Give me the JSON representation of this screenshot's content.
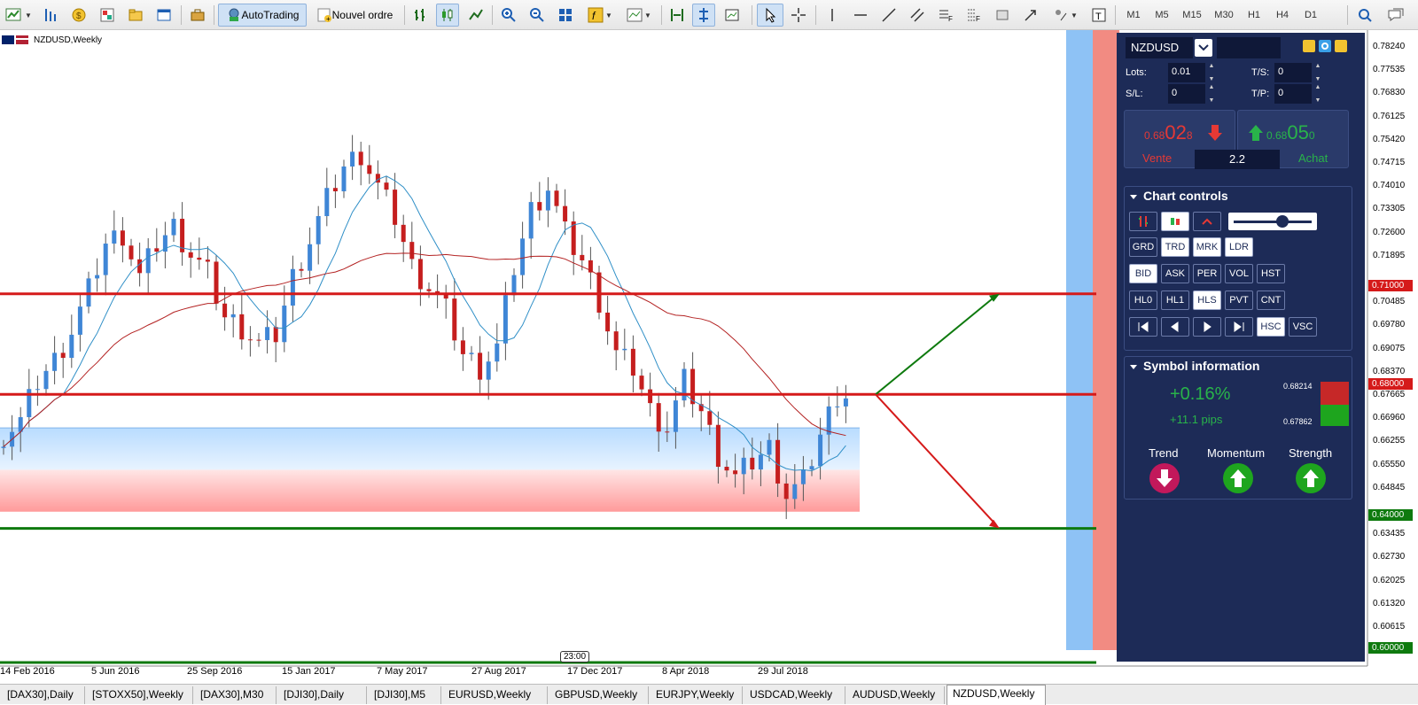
{
  "toolbar": {
    "autotrading_label": "AutoTrading",
    "new_order_label": "Nouvel ordre",
    "timeframes": [
      "M1",
      "M5",
      "M15",
      "M30",
      "H1",
      "H4",
      "D1"
    ]
  },
  "chart": {
    "title": "NZDUSD,Weekly",
    "crosshair_time": "23:00",
    "time_labels": [
      "14 Feb 2016",
      "5 Jun 2016",
      "25 Sep 2016",
      "15 Jan 2017",
      "7 May 2017",
      "27 Aug 2017",
      "17 Dec 2017",
      "8 Apr 2018",
      "29 Jul 2018"
    ],
    "price_labels": [
      "0.78240",
      "0.77535",
      "0.76830",
      "0.76125",
      "0.75420",
      "0.74715",
      "0.74010",
      "0.73305",
      "0.72600",
      "0.71895",
      "0.70485",
      "0.69780",
      "0.69075",
      "0.68370",
      "0.67665",
      "0.66960",
      "0.66255",
      "0.65550",
      "0.64845",
      "0.63435",
      "0.62730",
      "0.62025",
      "0.61320",
      "0.60615"
    ],
    "level_tags": [
      {
        "price": "0.71000",
        "color": "#d51a1a"
      },
      {
        "price": "0.68000",
        "color": "#d51a1a"
      },
      {
        "price": "0.64000",
        "color": "#0e7a0e"
      },
      {
        "price": "0.60000",
        "color": "#0e7a0e"
      }
    ],
    "colors": {
      "bull": "#3f86d6",
      "bear": "#c51e1e",
      "ma_fast": "#2f8fc7",
      "ma_slow": "#b32121",
      "resistance": "#d51a1a",
      "support": "#0e7a0e"
    }
  },
  "chart_data": {
    "type": "candlestick",
    "symbol": "NZDUSD",
    "timeframe": "Weekly",
    "x_range": [
      "14 Feb 2016",
      "29 Jul 2018"
    ],
    "ylim": [
      0.6,
      0.785
    ],
    "close_sample": [
      0.668,
      0.672,
      0.684,
      0.69,
      0.699,
      0.711,
      0.725,
      0.728,
      0.715,
      0.725,
      0.73,
      0.722,
      0.716,
      0.703,
      0.7,
      0.695,
      0.698,
      0.715,
      0.726,
      0.738,
      0.748,
      0.752,
      0.742,
      0.733,
      0.718,
      0.712,
      0.705,
      0.692,
      0.688,
      0.694,
      0.718,
      0.735,
      0.742,
      0.728,
      0.72,
      0.708,
      0.692,
      0.688,
      0.675,
      0.67,
      0.684,
      0.675,
      0.662,
      0.655,
      0.66,
      0.664,
      0.65,
      0.654,
      0.668,
      0.68
    ],
    "horizontal_levels": [
      0.71,
      0.68,
      0.64,
      0.6
    ],
    "zone": {
      "top": 0.67,
      "bottom": 0.645
    },
    "projection": {
      "from": 0.68,
      "up_to": 0.71,
      "down_to": 0.64
    }
  },
  "panel": {
    "symbol": "NZDUSD",
    "lots_label": "Lots:",
    "lots_value": "0.01",
    "ts_label": "T/S:",
    "ts_value": "0",
    "sl_label": "S/L:",
    "sl_value": "0",
    "tp_label": "T/P:",
    "tp_value": "0",
    "sell_prefix": "0.68",
    "sell_big": "02",
    "sell_small": "8",
    "buy_prefix": "0.68",
    "buy_big": "05",
    "buy_small": "0",
    "spread": "2.2",
    "sell_label": "Vente",
    "buy_label": "Achat",
    "chart_controls_title": "Chart controls",
    "row1": [
      "GRD",
      "TRD",
      "MRK",
      "LDR"
    ],
    "row2": [
      "BID",
      "ASK",
      "PER",
      "VOL",
      "HST"
    ],
    "row3": [
      "HL0",
      "HL1",
      "HLS",
      "PVT",
      "CNT"
    ],
    "row4_extra": [
      "HSC",
      "VSC"
    ],
    "symbol_info_title": "Symbol information",
    "change_pct": "+0.16%",
    "change_pips": "+11.1 pips",
    "high": "0.68214",
    "low": "0.67862",
    "trend_label": "Trend",
    "momentum_label": "Momentum",
    "strength_label": "Strength",
    "colors": {
      "bg": "#1d2b57",
      "up": "#29b34a",
      "down": "#c2185b"
    }
  },
  "tabs": [
    "[DAX30],Daily",
    "[STOXX50],Weekly",
    "[DAX30],M30",
    "[DJI30],Daily",
    "[DJI30],M5",
    "EURUSD,Weekly",
    "GBPUSD,Weekly",
    "EURJPY,Weekly",
    "USDCAD,Weekly",
    "AUDUSD,Weekly",
    "NZDUSD,Weekly"
  ],
  "active_tab": "NZDUSD,Weekly"
}
